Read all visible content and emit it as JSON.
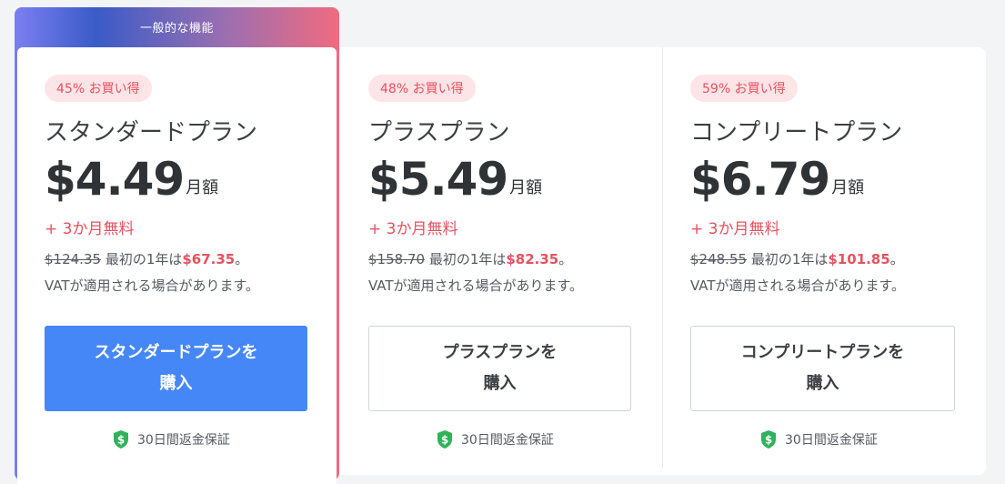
{
  "featured_label": "一般的な機能",
  "plans": [
    {
      "badge": "45% お買い得",
      "name": "スタンダードプラン",
      "price": "$4.49",
      "period": "月額",
      "bonus": "+ 3か月無料",
      "old_price": "$124.35",
      "first_year_text": "最初の1年は",
      "new_price": "$67.35",
      "suffix": "。",
      "vat": "VATが適用される場合があります。",
      "cta_line1": "スタンダードプランを",
      "cta_line2": "購入",
      "guarantee": "30日間返金保証"
    },
    {
      "badge": "48% お買い得",
      "name": "プラスプラン",
      "price": "$5.49",
      "period": "月額",
      "bonus": "+ 3か月無料",
      "old_price": "$158.70",
      "first_year_text": "最初の1年は",
      "new_price": "$82.35",
      "suffix": "。",
      "vat": "VATが適用される場合があります。",
      "cta_line1": "プラスプランを",
      "cta_line2": "購入",
      "guarantee": "30日間返金保証"
    },
    {
      "badge": "59% お買い得",
      "name": "コンプリートプラン",
      "price": "$6.79",
      "period": "月額",
      "bonus": "+ 3か月無料",
      "old_price": "$248.55",
      "first_year_text": "最初の1年は",
      "new_price": "$101.85",
      "suffix": "。",
      "vat": "VATが適用される場合があります。",
      "cta_line1": "コンプリートプランを",
      "cta_line2": "購入",
      "guarantee": "30日間返金保証"
    }
  ],
  "colors": {
    "accent_red": "#e8515f",
    "primary_button": "#4587f6",
    "badge_bg": "#fde4e7",
    "shield_green": "#2fb35a"
  }
}
